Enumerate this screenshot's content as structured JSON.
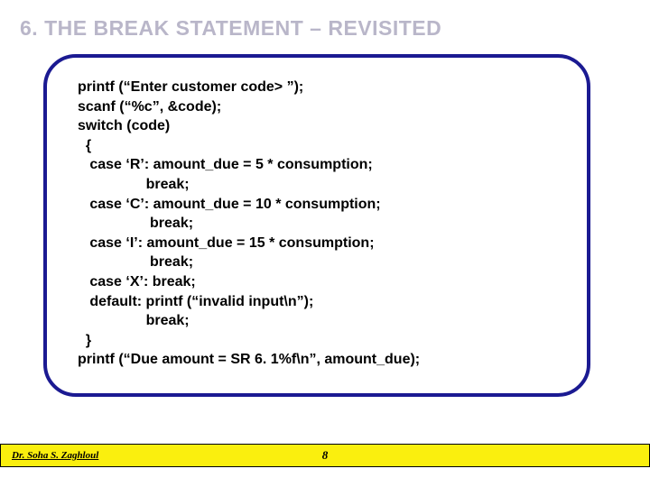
{
  "heading": "6. THE BREAK STATEMENT – REVISITED",
  "code": {
    "l1": "printf (“Enter customer code> ”);",
    "l2": "scanf (“%c”, &code);",
    "l3": "switch (code)",
    "l4": "  {",
    "l5": "   case ‘R’: amount_due = 5 * consumption;",
    "l6": "                 break;",
    "l7": "   case ‘C’: amount_due = 10 * consumption;",
    "l8": "                  break;",
    "l9": "   case ‘I’: amount_due = 15 * consumption;",
    "l10": "                  break;",
    "l11": "   case ‘X’: break;",
    "l12": "   default: printf (“invalid input\\n”);",
    "l13": "                 break;",
    "l14": "  }",
    "l15": "printf (“Due amount = SR 6. 1%f\\n”, amount_due);"
  },
  "footer": {
    "author": "Dr. Soha S. Zaghloul",
    "page": "8"
  }
}
